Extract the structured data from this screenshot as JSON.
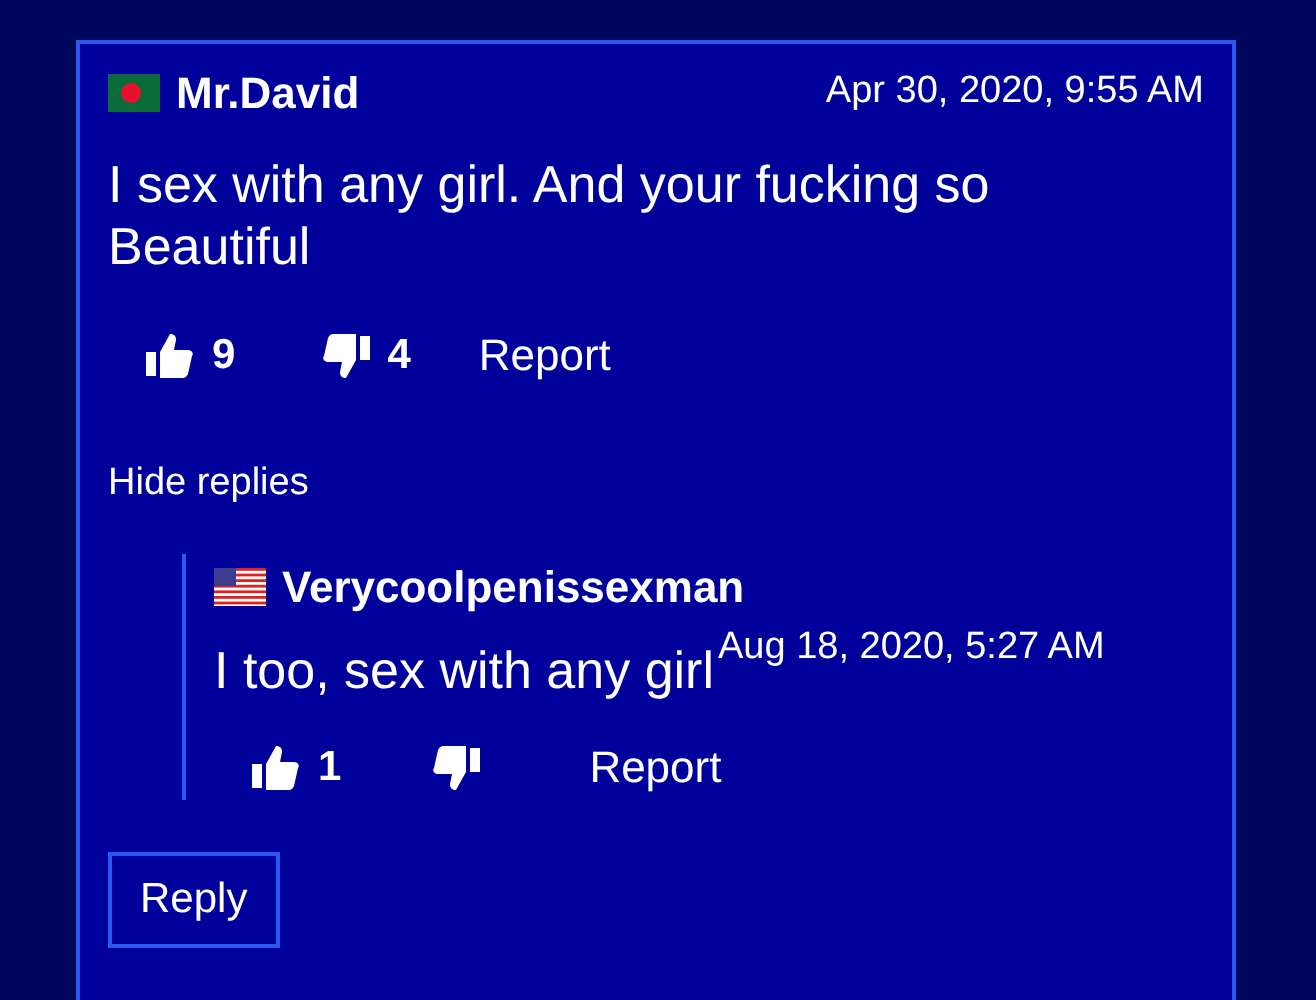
{
  "comment": {
    "kind": "bd",
    "author": "Mr.David",
    "time": "Apr 30, 2020, 9:55 AM",
    "text": "I sex with any girl. And your fucking so Beautiful",
    "likes": "9",
    "dislikes": "4",
    "report": "Report"
  },
  "toggle_replies": "Hide replies",
  "replies": [
    {
      "kind": "us",
      "author": "Verycoolpenissexman",
      "time": "Aug 18, 2020, 5:27 AM",
      "text": "I too, sex with any girl",
      "likes": "1",
      "report": "Report"
    }
  ],
  "reply_button": "Reply"
}
